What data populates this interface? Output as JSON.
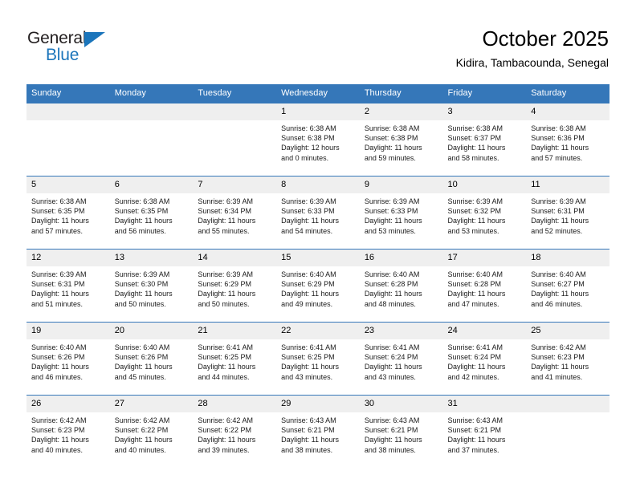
{
  "logo": {
    "word_top": "General",
    "word_bottom": "Blue",
    "triangle_icon": "blue-triangle-icon",
    "brand_color": "#1b75bb"
  },
  "header": {
    "month_title": "October 2025",
    "location": "Kidira, Tambacounda, Senegal"
  },
  "theme": {
    "header_blue": "#3577b9",
    "daynum_gray": "#efefef",
    "text_dark": "#1a1a1a"
  },
  "calendar": {
    "weekday_headers": [
      "Sunday",
      "Monday",
      "Tuesday",
      "Wednesday",
      "Thursday",
      "Friday",
      "Saturday"
    ],
    "weeks": [
      [
        {
          "day": "",
          "sunrise": "",
          "sunset": "",
          "daylight_line1": "",
          "daylight_line2": ""
        },
        {
          "day": "",
          "sunrise": "",
          "sunset": "",
          "daylight_line1": "",
          "daylight_line2": ""
        },
        {
          "day": "",
          "sunrise": "",
          "sunset": "",
          "daylight_line1": "",
          "daylight_line2": ""
        },
        {
          "day": "1",
          "sunrise": "Sunrise: 6:38 AM",
          "sunset": "Sunset: 6:38 PM",
          "daylight_line1": "Daylight: 12 hours",
          "daylight_line2": "and 0 minutes."
        },
        {
          "day": "2",
          "sunrise": "Sunrise: 6:38 AM",
          "sunset": "Sunset: 6:38 PM",
          "daylight_line1": "Daylight: 11 hours",
          "daylight_line2": "and 59 minutes."
        },
        {
          "day": "3",
          "sunrise": "Sunrise: 6:38 AM",
          "sunset": "Sunset: 6:37 PM",
          "daylight_line1": "Daylight: 11 hours",
          "daylight_line2": "and 58 minutes."
        },
        {
          "day": "4",
          "sunrise": "Sunrise: 6:38 AM",
          "sunset": "Sunset: 6:36 PM",
          "daylight_line1": "Daylight: 11 hours",
          "daylight_line2": "and 57 minutes."
        }
      ],
      [
        {
          "day": "5",
          "sunrise": "Sunrise: 6:38 AM",
          "sunset": "Sunset: 6:35 PM",
          "daylight_line1": "Daylight: 11 hours",
          "daylight_line2": "and 57 minutes."
        },
        {
          "day": "6",
          "sunrise": "Sunrise: 6:38 AM",
          "sunset": "Sunset: 6:35 PM",
          "daylight_line1": "Daylight: 11 hours",
          "daylight_line2": "and 56 minutes."
        },
        {
          "day": "7",
          "sunrise": "Sunrise: 6:39 AM",
          "sunset": "Sunset: 6:34 PM",
          "daylight_line1": "Daylight: 11 hours",
          "daylight_line2": "and 55 minutes."
        },
        {
          "day": "8",
          "sunrise": "Sunrise: 6:39 AM",
          "sunset": "Sunset: 6:33 PM",
          "daylight_line1": "Daylight: 11 hours",
          "daylight_line2": "and 54 minutes."
        },
        {
          "day": "9",
          "sunrise": "Sunrise: 6:39 AM",
          "sunset": "Sunset: 6:33 PM",
          "daylight_line1": "Daylight: 11 hours",
          "daylight_line2": "and 53 minutes."
        },
        {
          "day": "10",
          "sunrise": "Sunrise: 6:39 AM",
          "sunset": "Sunset: 6:32 PM",
          "daylight_line1": "Daylight: 11 hours",
          "daylight_line2": "and 53 minutes."
        },
        {
          "day": "11",
          "sunrise": "Sunrise: 6:39 AM",
          "sunset": "Sunset: 6:31 PM",
          "daylight_line1": "Daylight: 11 hours",
          "daylight_line2": "and 52 minutes."
        }
      ],
      [
        {
          "day": "12",
          "sunrise": "Sunrise: 6:39 AM",
          "sunset": "Sunset: 6:31 PM",
          "daylight_line1": "Daylight: 11 hours",
          "daylight_line2": "and 51 minutes."
        },
        {
          "day": "13",
          "sunrise": "Sunrise: 6:39 AM",
          "sunset": "Sunset: 6:30 PM",
          "daylight_line1": "Daylight: 11 hours",
          "daylight_line2": "and 50 minutes."
        },
        {
          "day": "14",
          "sunrise": "Sunrise: 6:39 AM",
          "sunset": "Sunset: 6:29 PM",
          "daylight_line1": "Daylight: 11 hours",
          "daylight_line2": "and 50 minutes."
        },
        {
          "day": "15",
          "sunrise": "Sunrise: 6:40 AM",
          "sunset": "Sunset: 6:29 PM",
          "daylight_line1": "Daylight: 11 hours",
          "daylight_line2": "and 49 minutes."
        },
        {
          "day": "16",
          "sunrise": "Sunrise: 6:40 AM",
          "sunset": "Sunset: 6:28 PM",
          "daylight_line1": "Daylight: 11 hours",
          "daylight_line2": "and 48 minutes."
        },
        {
          "day": "17",
          "sunrise": "Sunrise: 6:40 AM",
          "sunset": "Sunset: 6:28 PM",
          "daylight_line1": "Daylight: 11 hours",
          "daylight_line2": "and 47 minutes."
        },
        {
          "day": "18",
          "sunrise": "Sunrise: 6:40 AM",
          "sunset": "Sunset: 6:27 PM",
          "daylight_line1": "Daylight: 11 hours",
          "daylight_line2": "and 46 minutes."
        }
      ],
      [
        {
          "day": "19",
          "sunrise": "Sunrise: 6:40 AM",
          "sunset": "Sunset: 6:26 PM",
          "daylight_line1": "Daylight: 11 hours",
          "daylight_line2": "and 46 minutes."
        },
        {
          "day": "20",
          "sunrise": "Sunrise: 6:40 AM",
          "sunset": "Sunset: 6:26 PM",
          "daylight_line1": "Daylight: 11 hours",
          "daylight_line2": "and 45 minutes."
        },
        {
          "day": "21",
          "sunrise": "Sunrise: 6:41 AM",
          "sunset": "Sunset: 6:25 PM",
          "daylight_line1": "Daylight: 11 hours",
          "daylight_line2": "and 44 minutes."
        },
        {
          "day": "22",
          "sunrise": "Sunrise: 6:41 AM",
          "sunset": "Sunset: 6:25 PM",
          "daylight_line1": "Daylight: 11 hours",
          "daylight_line2": "and 43 minutes."
        },
        {
          "day": "23",
          "sunrise": "Sunrise: 6:41 AM",
          "sunset": "Sunset: 6:24 PM",
          "daylight_line1": "Daylight: 11 hours",
          "daylight_line2": "and 43 minutes."
        },
        {
          "day": "24",
          "sunrise": "Sunrise: 6:41 AM",
          "sunset": "Sunset: 6:24 PM",
          "daylight_line1": "Daylight: 11 hours",
          "daylight_line2": "and 42 minutes."
        },
        {
          "day": "25",
          "sunrise": "Sunrise: 6:42 AM",
          "sunset": "Sunset: 6:23 PM",
          "daylight_line1": "Daylight: 11 hours",
          "daylight_line2": "and 41 minutes."
        }
      ],
      [
        {
          "day": "26",
          "sunrise": "Sunrise: 6:42 AM",
          "sunset": "Sunset: 6:23 PM",
          "daylight_line1": "Daylight: 11 hours",
          "daylight_line2": "and 40 minutes."
        },
        {
          "day": "27",
          "sunrise": "Sunrise: 6:42 AM",
          "sunset": "Sunset: 6:22 PM",
          "daylight_line1": "Daylight: 11 hours",
          "daylight_line2": "and 40 minutes."
        },
        {
          "day": "28",
          "sunrise": "Sunrise: 6:42 AM",
          "sunset": "Sunset: 6:22 PM",
          "daylight_line1": "Daylight: 11 hours",
          "daylight_line2": "and 39 minutes."
        },
        {
          "day": "29",
          "sunrise": "Sunrise: 6:43 AM",
          "sunset": "Sunset: 6:21 PM",
          "daylight_line1": "Daylight: 11 hours",
          "daylight_line2": "and 38 minutes."
        },
        {
          "day": "30",
          "sunrise": "Sunrise: 6:43 AM",
          "sunset": "Sunset: 6:21 PM",
          "daylight_line1": "Daylight: 11 hours",
          "daylight_line2": "and 38 minutes."
        },
        {
          "day": "31",
          "sunrise": "Sunrise: 6:43 AM",
          "sunset": "Sunset: 6:21 PM",
          "daylight_line1": "Daylight: 11 hours",
          "daylight_line2": "and 37 minutes."
        },
        {
          "day": "",
          "sunrise": "",
          "sunset": "",
          "daylight_line1": "",
          "daylight_line2": ""
        }
      ]
    ]
  }
}
